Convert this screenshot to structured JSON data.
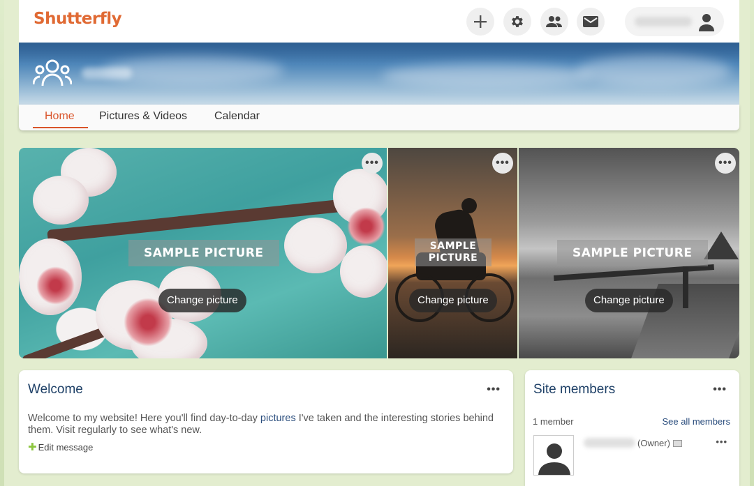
{
  "header": {
    "logo": "Shutterfly",
    "icons": [
      "plus-icon",
      "gear-icon",
      "people-icon",
      "mail-icon",
      "user-icon"
    ]
  },
  "nav": {
    "tabs": [
      {
        "label": "Home",
        "active": true
      },
      {
        "label": "Pictures & Videos",
        "active": false
      },
      {
        "label": "Calendar",
        "active": false
      }
    ]
  },
  "photos": [
    {
      "label": "SAMPLE PICTURE",
      "button": "Change picture",
      "more": "•••"
    },
    {
      "label": "SAMPLE PICTURE",
      "button": "Change picture",
      "more": "•••"
    },
    {
      "label": "SAMPLE PICTURE",
      "button": "Change picture",
      "more": "•••"
    }
  ],
  "welcome": {
    "title": "Welcome",
    "text_before": "Welcome to my website! Here you'll find day-to-day ",
    "link": "pictures",
    "text_after": " I've taken and the interesting stories behind them. Visit regularly to see what's new.",
    "edit": "Edit message",
    "more": "•••"
  },
  "members": {
    "title": "Site members",
    "count": "1 member",
    "see_all": "See all members",
    "owner": "(Owner)",
    "more": "•••",
    "member_more": "•••"
  },
  "colors": {
    "brand": "#e06a34",
    "active_tab": "#d9542a",
    "title": "#1d3f66",
    "edit_plus": "#8dc63f"
  }
}
